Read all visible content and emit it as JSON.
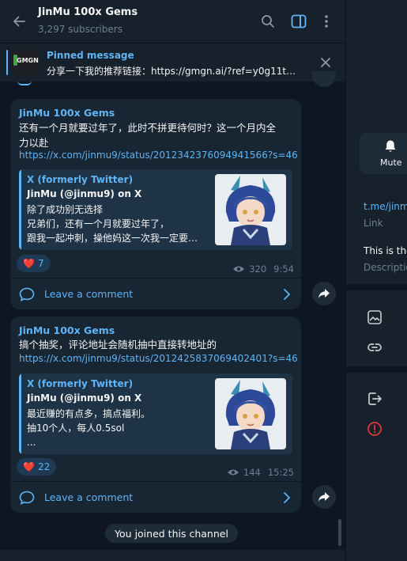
{
  "header": {
    "title": "JinMu 100x Gems",
    "subscribers": "3,297 subscribers"
  },
  "pinned": {
    "label": "Pinned message",
    "text": "分享一下我的推荐链接：https://gmgn.ai/?ref=y0g11t…",
    "thumb_text": "GMGN"
  },
  "posts": [
    {
      "author": "JinMu 100x Gems",
      "text_lines": [
        "还有一个月就要过年了，此时不拼更待何时？这一个月内全",
        "力以赴"
      ],
      "link": "https://x.com/jinmu9/status/2012342376094941566?s=46",
      "preview": {
        "site": "X (formerly Twitter)",
        "title": "JinMu (@jinmu9) on X",
        "desc_lines": [
          "除了成功别无选择",
          "兄弟们，还有一个月就要过年了，",
          "跟我一起冲刺，操他妈这一次我一定要…"
        ]
      },
      "reaction": {
        "emoji": "❤️",
        "count": "7"
      },
      "views": "320",
      "time": "9:54",
      "comment_label": "Leave a comment"
    },
    {
      "author": "JinMu 100x Gems",
      "text_lines": [
        "搞个抽奖，评论地址会随机抽中直接转地址的"
      ],
      "link": "https://x.com/jinmu9/status/2012425837069402401?s=46",
      "preview": {
        "site": "X (formerly Twitter)",
        "title": "JinMu (@jinmu9) on X",
        "desc_lines": [
          "最近赚的有点多，搞点福利。",
          "抽10个人，每人0.5sol",
          "..."
        ]
      },
      "reaction": {
        "emoji": "❤️",
        "count": "22"
      },
      "views": "144",
      "time": "15:25",
      "comment_label": "Leave a comment"
    }
  ],
  "joined_text": "You joined this channel",
  "right_panel": {
    "mute_label": "Mute",
    "link_value": "t.me/jinm",
    "link_caption": "Link",
    "description_value": "This is the",
    "description_caption": "Descriptio"
  },
  "colors": {
    "accent": "#5eb5f7",
    "bubble": "#182533",
    "background": "#0e1621",
    "panel": "#17212b",
    "danger": "#e53935"
  }
}
